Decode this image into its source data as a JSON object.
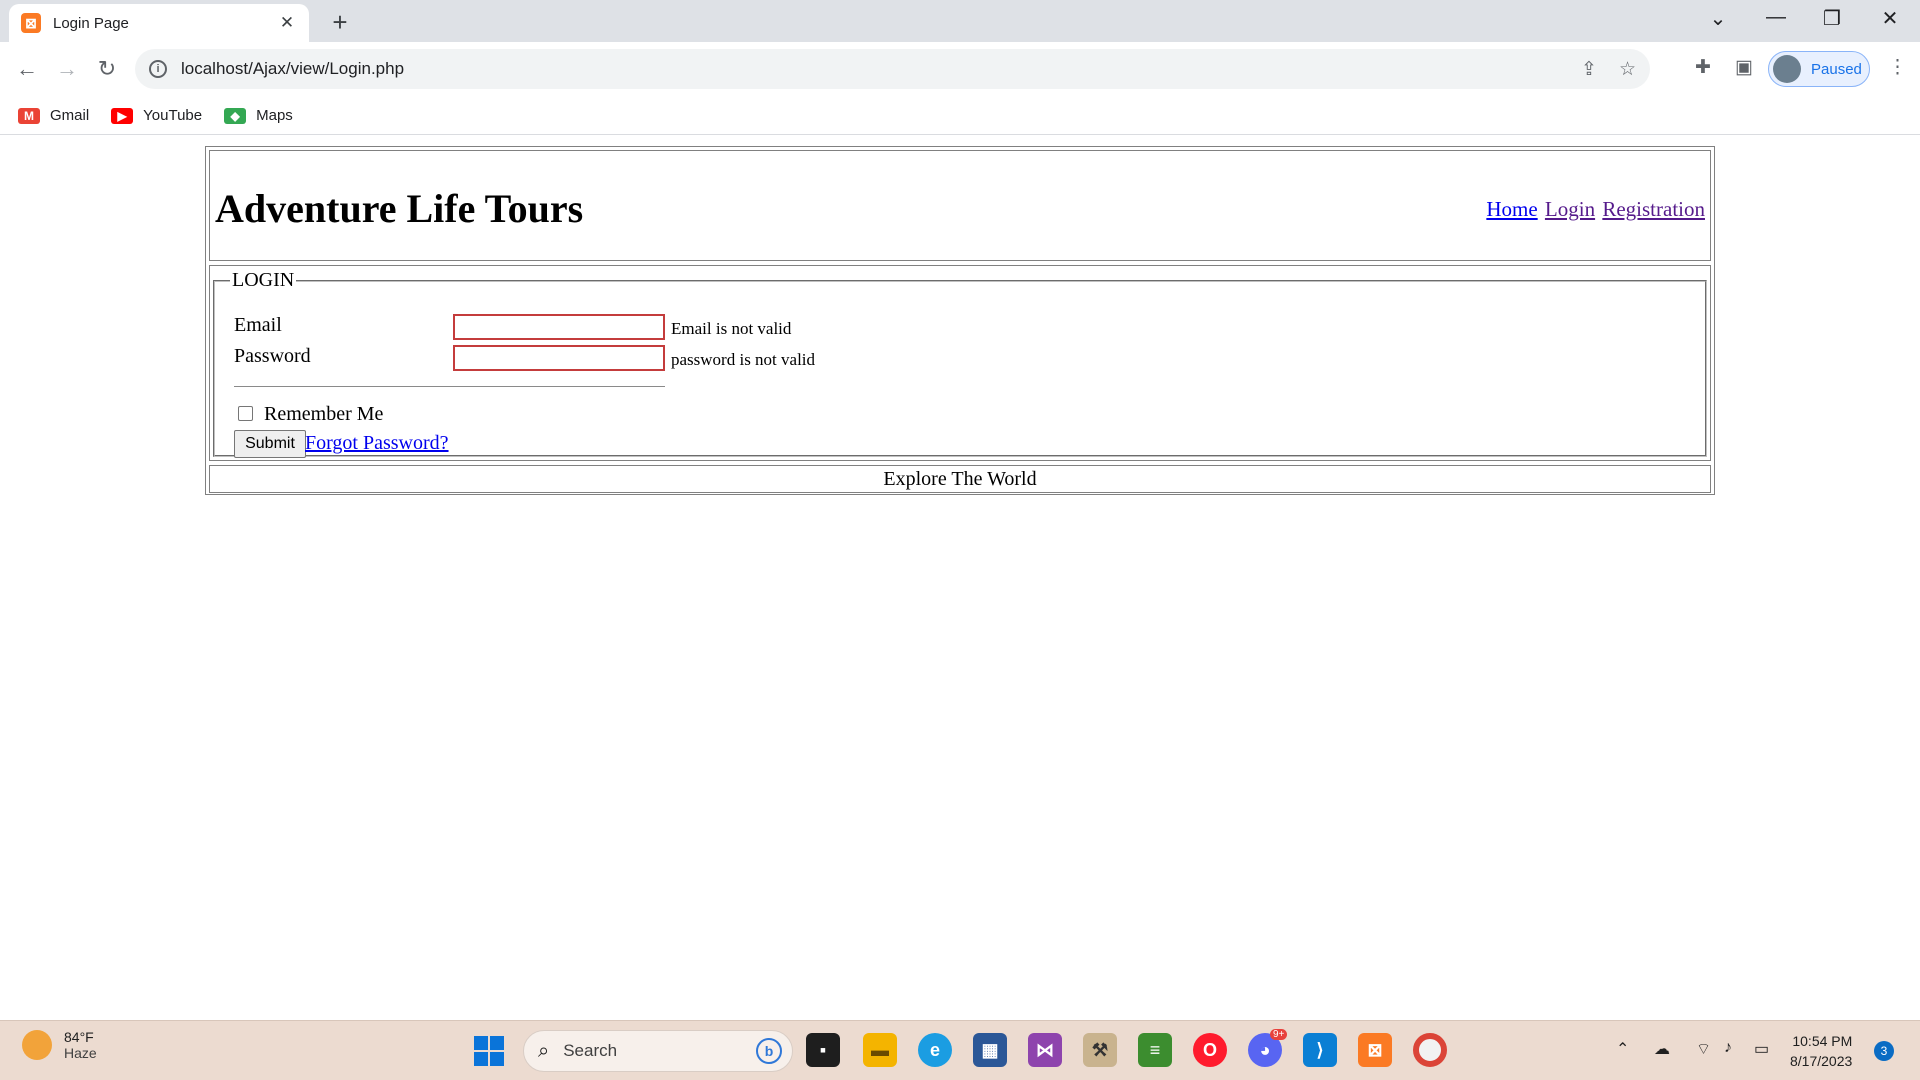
{
  "browser": {
    "tab_title": "Login Page",
    "tab_favicon": "xampp-icon",
    "url": "localhost/Ajax/view/Login.php",
    "profile_status": "Paused",
    "bookmarks": [
      {
        "label": "Gmail",
        "icon": "gmail-icon",
        "color": "#ea4335"
      },
      {
        "label": "YouTube",
        "icon": "youtube-icon",
        "color": "#ff0000"
      },
      {
        "label": "Maps",
        "icon": "maps-icon",
        "color": "#34a853"
      }
    ]
  },
  "site": {
    "title": "Adventure Life Tours",
    "nav": [
      {
        "label": "Home",
        "visited": false
      },
      {
        "label": "Login",
        "visited": true
      },
      {
        "label": "Registration",
        "visited": true
      }
    ]
  },
  "login_form": {
    "legend": "LOGIN",
    "email_label": "Email",
    "email_value": "",
    "email_error": "Email is not valid",
    "password_label": "Password",
    "password_value": "",
    "password_error": "password is not valid",
    "remember_label": "Remember Me",
    "remember_checked": false,
    "submit_label": "Submit",
    "forgot_label": "Forgot Password?"
  },
  "footer": {
    "text": "Explore The World"
  },
  "taskbar": {
    "weather_temp": "84°F",
    "weather_desc": "Haze",
    "search_placeholder": "Search",
    "time": "10:54 PM",
    "date": "8/17/2023",
    "notification_count": "3",
    "discord_badge": "9+"
  },
  "colors": {
    "error_border": "#c43c3c",
    "link": "#0000ee",
    "visited_link": "#551a8b"
  }
}
